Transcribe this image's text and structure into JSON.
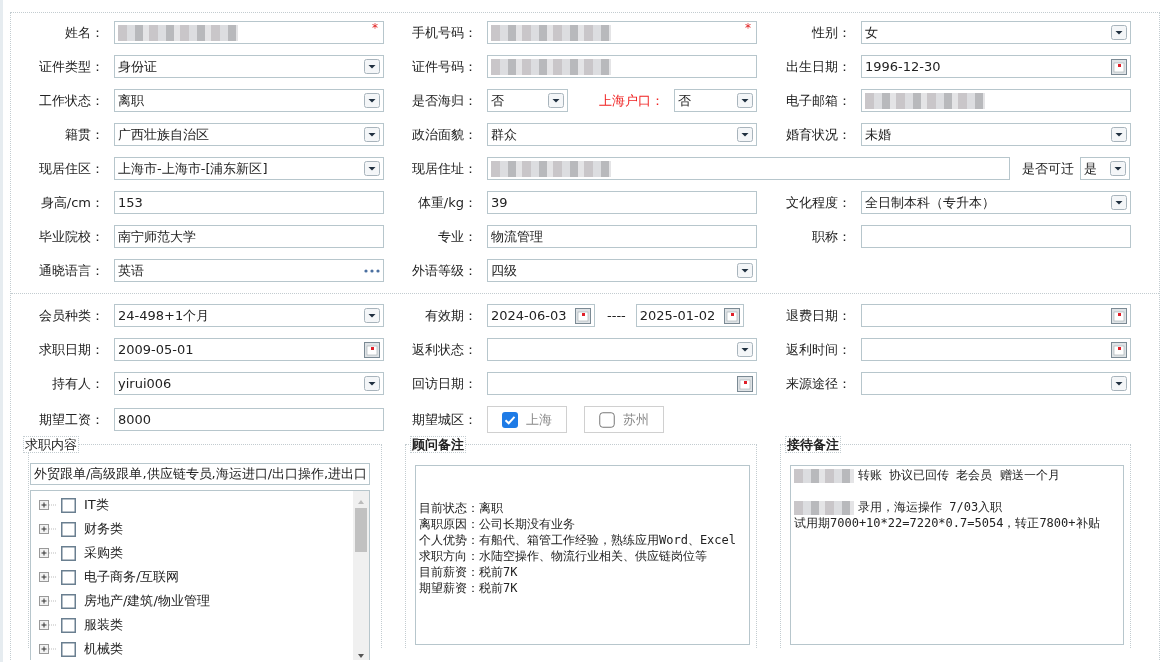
{
  "basic_info": {
    "rows": [
      [
        {
          "label": "姓名：",
          "kind": "text",
          "redacted": true,
          "required_mark": "*"
        },
        {
          "label": "手机号码：",
          "kind": "text",
          "redacted": true,
          "required_mark": "*"
        },
        {
          "label": "性别：",
          "kind": "select",
          "value": "女"
        }
      ],
      [
        {
          "label": "证件类型：",
          "kind": "select",
          "value": "身份证"
        },
        {
          "label": "证件号码：",
          "kind": "text",
          "redacted": true
        },
        {
          "label": "出生日期：",
          "kind": "date",
          "value": "1996-12-30"
        }
      ],
      [
        {
          "label": "工作状态：",
          "kind": "select",
          "value": "离职"
        },
        {
          "label": "是否海归：",
          "kind": "select",
          "value": "否",
          "extra": {
            "label": "上海户口：",
            "kind": "select",
            "value": "否",
            "emphasis": true
          }
        },
        {
          "label": "电子邮箱：",
          "kind": "text",
          "redacted": true
        }
      ],
      [
        {
          "label": "籍贯：",
          "kind": "select",
          "value": "广西壮族自治区"
        },
        {
          "label": "政治面貌：",
          "kind": "select",
          "value": "群众"
        },
        {
          "label": "婚育状况：",
          "kind": "select",
          "value": "未婚"
        }
      ],
      [
        {
          "label": "现居住区：",
          "kind": "select",
          "value": " 上海市-上海市-[浦东新区]"
        },
        {
          "label": "现居住址：",
          "kind": "text",
          "redacted": true,
          "extra": {
            "label": "是否可迁",
            "kind": "select",
            "value": "是",
            "emphasis": false
          }
        }
      ],
      [
        {
          "label": "身高/cm：",
          "kind": "text",
          "value": "153"
        },
        {
          "label": "体重/kg：",
          "kind": "text",
          "value": "39"
        },
        {
          "label": "文化程度：",
          "kind": "select",
          "value": "全日制本科（专升本）"
        }
      ],
      [
        {
          "label": "毕业院校：",
          "kind": "text",
          "value": "南宁师范大学"
        },
        {
          "label": "专业：",
          "kind": "text",
          "value": "物流管理"
        },
        {
          "label": "职称：",
          "kind": "text"
        }
      ],
      [
        {
          "label": "通晓语言：",
          "kind": "lookup",
          "value": "英语"
        },
        {
          "label": "外语等级：",
          "kind": "select",
          "value": "四级"
        }
      ]
    ]
  },
  "membership": {
    "rows": [
      [
        {
          "label": "会员种类：",
          "kind": "select",
          "value": " 24-498+1个月"
        },
        {
          "label": "有效期：",
          "kind": "daterange",
          "values": [
            "2024-06-03",
            "2025-01-02"
          ],
          "separator": "----"
        },
        {
          "label": "退费日期：",
          "kind": "date"
        }
      ],
      [
        {
          "label": "求职日期：",
          "kind": "date",
          "value": "2009-05-01"
        },
        {
          "label": "返利状态：",
          "kind": "select"
        },
        {
          "label": "返利时间：",
          "kind": "date"
        }
      ],
      [
        {
          "label": "持有人：",
          "kind": "select",
          "value": "yirui006"
        },
        {
          "label": "回访日期：",
          "kind": "date"
        },
        {
          "label": "来源途径：",
          "kind": "select"
        }
      ],
      [
        {
          "label": "期望工资：",
          "kind": "text",
          "value": "8000"
        },
        {
          "label": "期望城区：",
          "kind": "checks",
          "options": [
            {
              "label": "上海",
              "checked": true
            },
            {
              "label": "苏州",
              "checked": false
            }
          ]
        }
      ]
    ]
  },
  "job_content": {
    "legend": "求职内容",
    "value": "外贸跟单/高级跟单,供应链专员,海运进口/出口操作,进出口",
    "tree": [
      {
        "label": "IT类",
        "expanded": false,
        "checked": false
      },
      {
        "label": "财务类",
        "expanded": false,
        "checked": false
      },
      {
        "label": "采购类",
        "expanded": false,
        "checked": false
      },
      {
        "label": "电子商务/互联网",
        "expanded": false,
        "checked": false
      },
      {
        "label": "房地产/建筑/物业管理",
        "expanded": false,
        "checked": false
      },
      {
        "label": "服装类",
        "expanded": false,
        "checked": false
      },
      {
        "label": "机械类",
        "expanded": false,
        "checked": false
      }
    ]
  },
  "consultant_notes": {
    "legend": "顾问备注",
    "lines": [
      {
        "text": "目前状态：离职"
      },
      {
        "text": "离职原因：公司长期没有业务"
      },
      {
        "text": "个人优势：有船代、箱管工作经验，熟练应用Word、Excel"
      },
      {
        "text": "求职方向：水陆空操作、物流行业相关、供应链岗位等"
      },
      {
        "text": "目前薪资：税前7K"
      },
      {
        "text": "期望薪资：税前7K"
      }
    ]
  },
  "reception_notes": {
    "legend": "接待备注",
    "paragraphs": [
      [
        {
          "text": "转账 协议已回传 老会员  赠送一个月",
          "redacted": true
        }
      ],
      [
        {
          "text": "录用，海运操作 7/03入职",
          "redacted": true
        },
        {
          "text": "试用期7000+10*22=7220*0.7=5054，转正7800+补贴"
        }
      ]
    ]
  }
}
